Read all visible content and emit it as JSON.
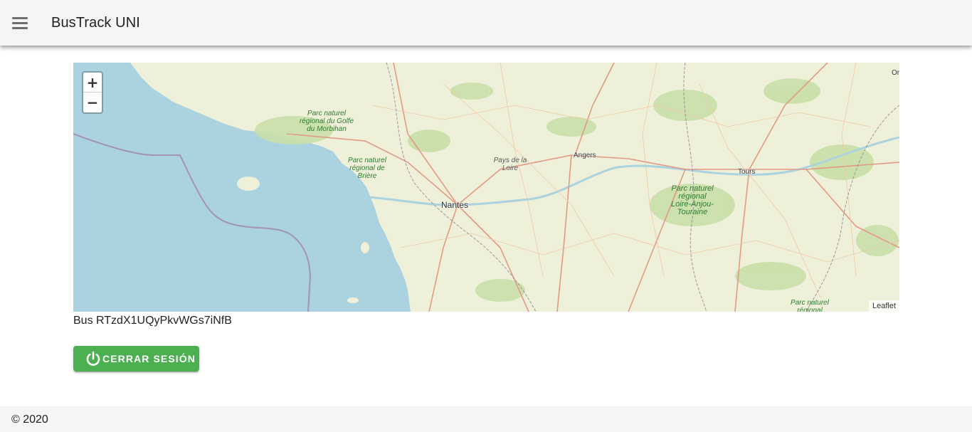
{
  "app_bar": {
    "menu_icon": "hamburger-menu-icon",
    "title": "BusTrack UNI"
  },
  "map": {
    "zoom_in": "+",
    "zoom_out": "−",
    "attribution": "Leaflet",
    "places": {
      "nantes": "Nantes",
      "angers": "Angers",
      "tours": "Tours",
      "pays_de_la_loire": "Pays de la Loire",
      "parc_golfe": "Parc naturel régional du Golfe du Morbihan",
      "parc_briere": "Parc naturel régional de Brière",
      "parc_loire_anjou": "Parc naturel régional Loire-Anjou-Touraine",
      "parc_bottom": "Parc naturel régional",
      "orleans_cut": "Or"
    },
    "colors": {
      "sea": "#aad3df",
      "land": "#eef0da",
      "forest": "#c8dfa7",
      "road": "#e8a08a"
    }
  },
  "bus": {
    "label": "Bus RTzdX1UQyPkvWGs7iNfB"
  },
  "logout_button": {
    "icon": "power-icon",
    "label": "CERRAR SESIÓN",
    "color": "#4caf50"
  },
  "footer": {
    "copyright": "© 2020"
  }
}
